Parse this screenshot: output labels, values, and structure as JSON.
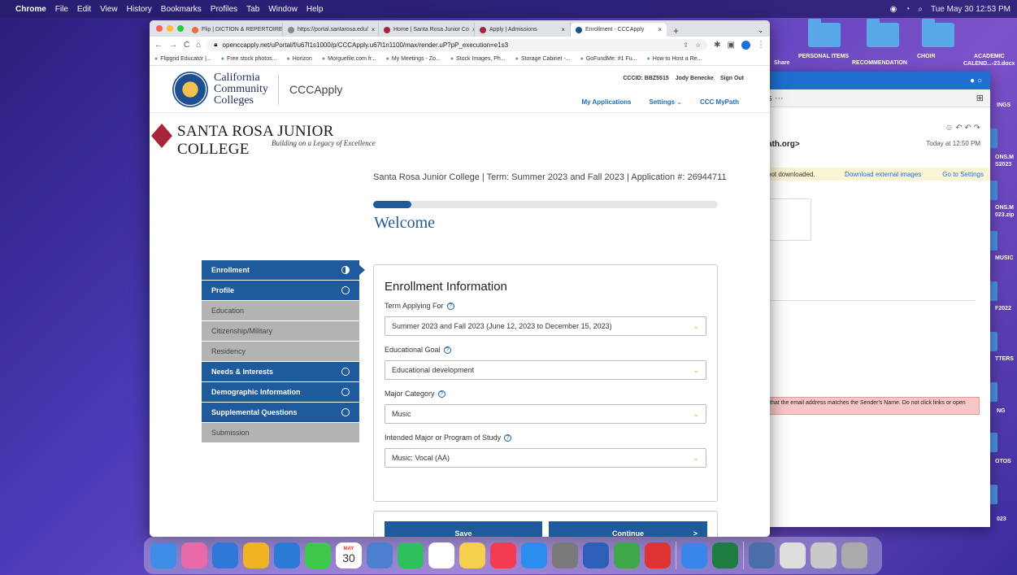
{
  "menubar": {
    "items": [
      "Chrome",
      "File",
      "Edit",
      "View",
      "History",
      "Bookmarks",
      "Profiles",
      "Tab",
      "Window",
      "Help"
    ],
    "clock": "Tue May 30 12:53 PM"
  },
  "desktop": {
    "labels": {
      "share": "Share",
      "personal_items": "PERSONAL ITEMS",
      "recommendation": "RECOMMENDATION",
      "choir": "CHOIR",
      "academic": "ACADEMIC",
      "calendar": "CALEND...-23.docx",
      "ings": "INGS",
      "onsm1": "ONS.M",
      "s2023": "S2023",
      "onsm2": "ONS.M",
      "zip": "023.zip",
      "music": "MUSIC",
      "f2022": "F2022",
      "tters": "TTERS",
      "ng": "NG",
      "otos": "OTOS",
      "023": "023"
    }
  },
  "mail": {
    "toolbar_more": "ns  ···",
    "from": "ath.org>",
    "time": "Today at 12:50 PM",
    "warn": "not downloaded.",
    "download": "Download external images",
    "settings": "Go to Settings",
    "alert": "that the email address matches the Sender's Name. Do not click links or open"
  },
  "browser": {
    "tabs": [
      {
        "label": "Flip | DICTION & REPERTOIRE"
      },
      {
        "label": "https://portal.santarosa.edu/"
      },
      {
        "label": "Home | Santa Rosa Junior Co"
      },
      {
        "label": "Apply | Admissions"
      },
      {
        "label": "Enrollment - CCCApply"
      }
    ],
    "url": "openccapply.net/uPortal/f/u67l1s1000/p/CCCApply.u67l1n1100/max/render.uP?pP_execution=e1s3",
    "bookmarks": [
      "Flipgrid Educator |...",
      "Free stock photos...",
      "Horizon",
      "Morguefile.com fr...",
      "My Meetings - Zo...",
      "Stock Images, Ph...",
      "Storage Cabinet -...",
      "GoFundMe: #1 Fu...",
      "How to Host a Re..."
    ]
  },
  "ccc": {
    "org_line1": "California",
    "org_line2": "Community",
    "org_line3": "Colleges",
    "app_name": "CCCApply",
    "cccid": "CCCID: BBZ5515",
    "user": "Jody Benecke",
    "signout": "Sign Out",
    "nav": [
      "My Applications",
      "Settings",
      "CCC MyPath"
    ]
  },
  "college": {
    "name": "SANTA ROSA JUNIOR COLLEGE",
    "tagline": "Building on a Legacy of Excellence"
  },
  "application": {
    "meta": "Santa Rosa Junior College | Term: Summer 2023 and Fall 2023 | Application #: 26944711",
    "progress": 0.11,
    "heading": "Welcome"
  },
  "sidenav": [
    {
      "label": "Enrollment",
      "style": "blue",
      "status": "half"
    },
    {
      "label": "Profile",
      "style": "blue",
      "status": "empty"
    },
    {
      "label": "Education",
      "style": "grey",
      "status": "none"
    },
    {
      "label": "Citizenship/Military",
      "style": "grey",
      "status": "none"
    },
    {
      "label": "Residency",
      "style": "grey",
      "status": "none"
    },
    {
      "label": "Needs & Interests",
      "style": "blue",
      "status": "empty"
    },
    {
      "label": "Demographic Information",
      "style": "blue",
      "status": "empty"
    },
    {
      "label": "Supplemental Questions",
      "style": "blue",
      "status": "empty"
    },
    {
      "label": "Submission",
      "style": "grey",
      "status": "none"
    }
  ],
  "form": {
    "title": "Enrollment Information",
    "fields": [
      {
        "label": "Term Applying For",
        "value": "Summer 2023 and Fall 2023 (June 12, 2023 to December 15, 2023)"
      },
      {
        "label": "Educational Goal",
        "value": "Educational development"
      },
      {
        "label": "Major Category",
        "value": "Music"
      },
      {
        "label": "Intended Major or Program of Study",
        "value": "Music: Vocal (AA)"
      }
    ],
    "save_label": "Save",
    "continue_label": "Continue",
    "continue_arrow": ">"
  },
  "dock": {
    "calendar_month": "MAY",
    "calendar_day": "30",
    "icon_colors": [
      "#3d8de6",
      "#e86aa8",
      "#2f78d9",
      "#f0b323",
      "#2a7ad6",
      "#3ec84a",
      "#f26b3a",
      "#4c7fcf",
      "#2fc05d",
      "#ffffff",
      "#f6d04d",
      "#f43b54",
      "#2d8cf0",
      "#7a7a7a",
      "#2b5fb8",
      "#3ca84a",
      "#d33",
      "#3a85e8",
      "#1e7c40",
      "#4a6fa8",
      "#dedede",
      "#c9c9c9",
      "#aaaaaa"
    ]
  }
}
